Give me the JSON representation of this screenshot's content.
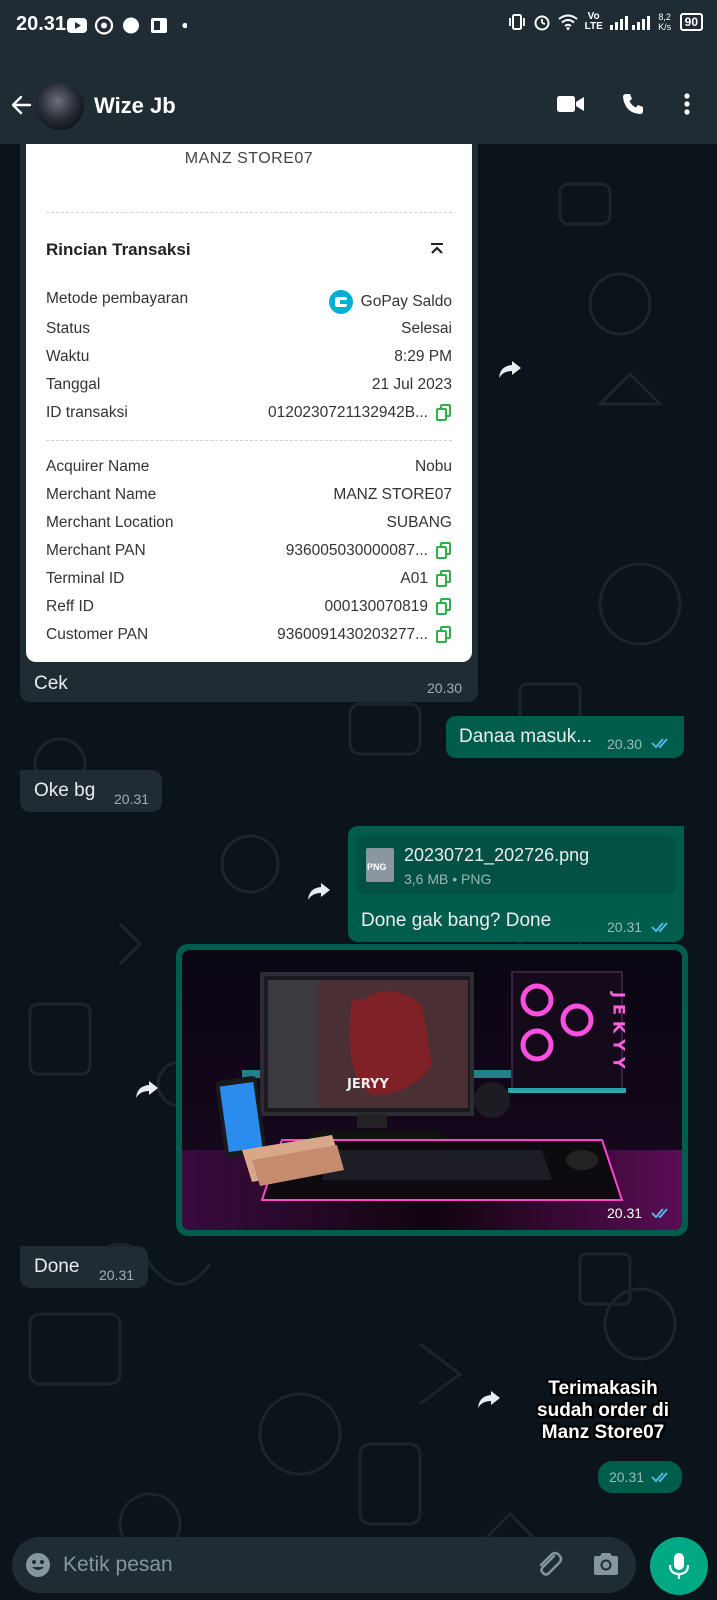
{
  "status_bar": {
    "time": "20.31",
    "lte": "Vo LTE",
    "speed": "8,2 K/s",
    "battery": "90"
  },
  "header": {
    "contact_name": "Wize Jb",
    "back_icon": "arrow-left-icon",
    "video_icon": "video-call-icon",
    "call_icon": "phone-icon",
    "menu_icon": "more-vertical-icon"
  },
  "receipt": {
    "store": "MANZ STORE07",
    "section_title": "Rincian Transaksi",
    "rows": [
      {
        "label": "Metode pembayaran",
        "value": "GoPay Saldo"
      },
      {
        "label": "Status",
        "value": "Selesai"
      },
      {
        "label": "Waktu",
        "value": "8:29 PM"
      },
      {
        "label": "Tanggal",
        "value": "21 Jul 2023"
      },
      {
        "label": "ID transaksi",
        "value": "0120230721132942B..."
      }
    ],
    "merchant_rows": [
      {
        "label": "Acquirer Name",
        "value": "Nobu"
      },
      {
        "label": "Merchant Name",
        "value": "MANZ STORE07"
      },
      {
        "label": "Merchant Location",
        "value": "SUBANG"
      },
      {
        "label": "Merchant PAN",
        "value": "936005030000087..."
      },
      {
        "label": "Terminal ID",
        "value": "A01"
      },
      {
        "label": "Reff ID",
        "value": "000130070819"
      },
      {
        "label": "Customer PAN",
        "value": "9360091430203277..."
      }
    ]
  },
  "messages": [
    {
      "id": "m1",
      "direction": "incoming",
      "text": "Cek",
      "time": "20.30"
    },
    {
      "id": "m2",
      "direction": "outgoing",
      "text": "Danaa masuk...",
      "time": "20.30"
    },
    {
      "id": "m3",
      "direction": "incoming",
      "text": "Oke bg",
      "time": "20.31"
    },
    {
      "id": "m4",
      "direction": "outgoing",
      "text": "Done gak bang? Done",
      "time": "20.31",
      "file": {
        "name": "20230721_202726.png",
        "size": "3,6 MB",
        "type": "PNG",
        "icon_label": "PNG"
      }
    },
    {
      "id": "m5",
      "direction": "outgoing",
      "media": "photo",
      "time": "20.31"
    },
    {
      "id": "m6",
      "direction": "incoming",
      "text": "Done",
      "time": "20.31"
    },
    {
      "id": "m7",
      "direction": "outgoing",
      "sticker_text": [
        "Terimakasih",
        "sudah order di",
        "Manz Store07"
      ]
    },
    {
      "id": "m8",
      "direction": "outgoing",
      "time": "20.31"
    }
  ],
  "photo_texts": {
    "monitor_logo": "JERYY",
    "neon_sign": "JEKYY"
  },
  "input": {
    "placeholder": "Ketik pesan"
  },
  "colors": {
    "header": "#1f2c34",
    "background": "#0b141a",
    "incoming": "#1f2c34",
    "outgoing": "#005c4b",
    "accent": "#00a884",
    "read_ticks": "#53bdeb"
  }
}
